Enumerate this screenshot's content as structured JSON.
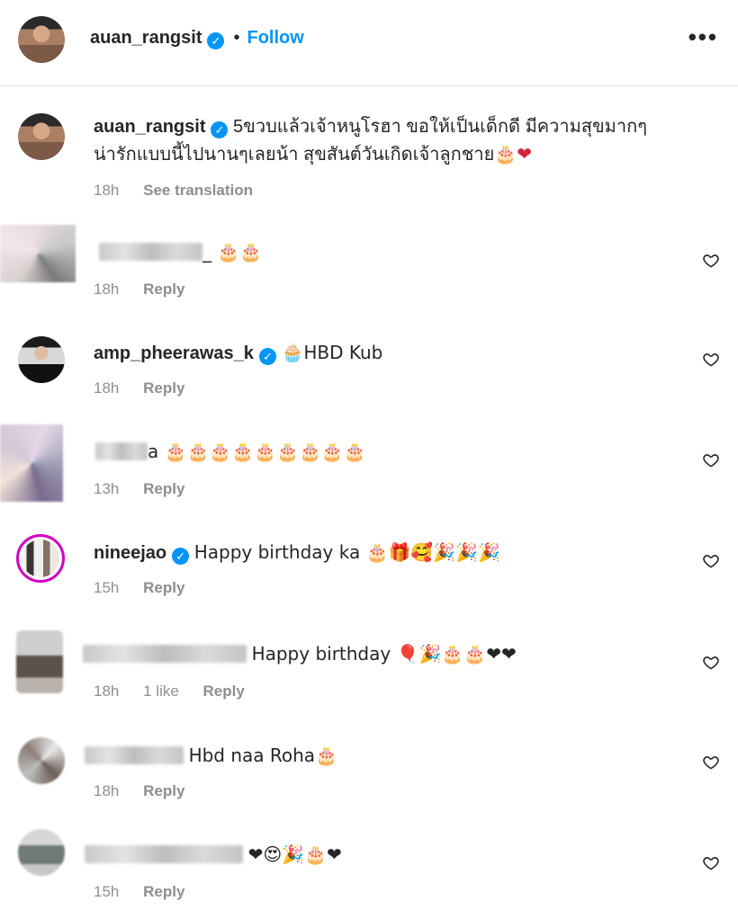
{
  "post_header": {
    "username": "auan_rangsit",
    "dot": "•",
    "follow_label": "Follow",
    "more_label": "•••"
  },
  "caption": {
    "username": "auan_rangsit",
    "text_line1": "5ขวบแล้วเจ้าหนูโรฮา ขอให้เป็นเด็กดี มีความสุขมากๆ",
    "text_line2": "น่ารักแบบนี้ไปนานๆเลยน้า สุขสันต์วันเกิดเจ้าลูกชาย",
    "emojis": "🎂❤",
    "time": "18h",
    "translate_label": "See translation"
  },
  "comments": [
    {
      "username": "",
      "text": "_ 🎂🎂",
      "time": "18h",
      "likes": "",
      "reply_label": "Reply"
    },
    {
      "username": "amp_pheerawas_k",
      "text": "🧁HBD Kub",
      "time": "18h",
      "likes": "",
      "reply_label": "Reply"
    },
    {
      "username": "",
      "text": "a 🎂🎂🎂🎂🎂🎂🎂🎂🎂",
      "time": "13h",
      "likes": "",
      "reply_label": "Reply"
    },
    {
      "username": "nineejao",
      "text": "Happy birthday ka 🎂🎁🥰🎉🎉🎉",
      "time": "15h",
      "likes": "",
      "reply_label": "Reply"
    },
    {
      "username": "",
      "text": "Happy birthday 🎈🎉🎂🎂❤❤",
      "time": "18h",
      "likes": "1 like",
      "reply_label": "Reply"
    },
    {
      "username": "",
      "text": "Hbd naa Roha🎂",
      "time": "18h",
      "likes": "",
      "reply_label": "Reply"
    },
    {
      "username": "",
      "text": "❤😍🎉🎂❤",
      "time": "15h",
      "likes": "",
      "reply_label": "Reply"
    }
  ],
  "colors": {
    "accent": "#0095f6",
    "heart_red": "#ed4956",
    "muted": "#8e8e8e"
  }
}
